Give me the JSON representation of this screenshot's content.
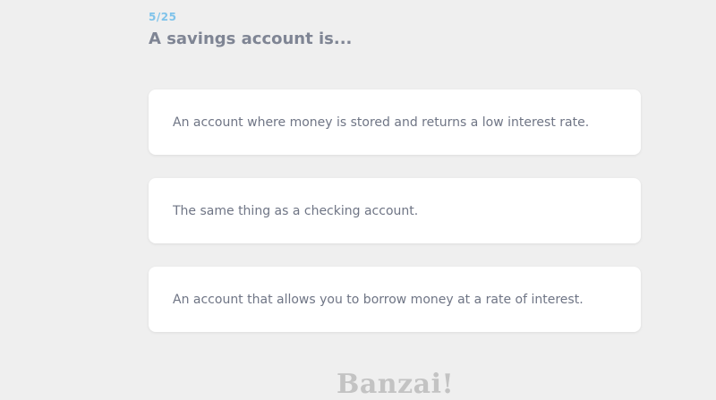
{
  "quiz": {
    "progress": "5/25",
    "question": "A savings account is...",
    "answers": [
      "An account where money is stored and returns a low interest rate.",
      "The same thing as a checking account.",
      "An account that allows you to borrow money at a rate of interest."
    ]
  },
  "brand": {
    "logo_text": "Banzai!"
  },
  "colors": {
    "background": "#efefef",
    "accent": "#7fc3ea",
    "question_text": "#7f8594",
    "answer_text": "#6f7585",
    "card": "#ffffff",
    "logo": "#c3c3c3"
  }
}
